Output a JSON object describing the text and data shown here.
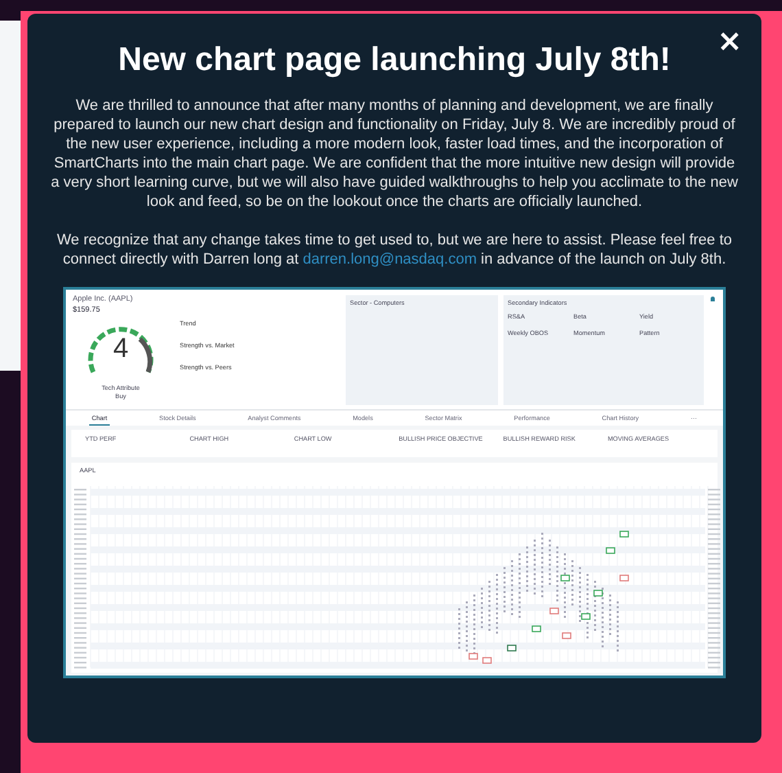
{
  "modal": {
    "close": "×",
    "title": "New chart page launching July 8th!",
    "intro": "We are thrilled to announce that after many months of planning and development, we are finally prepared to launch our new chart design and functionality on Friday, July 8. We are incredibly proud of the new user experience, including a more modern look, faster load times, and the incorporation of SmartCharts into the main chart page. We are confident that the more intuitive new design will provide a very short learning curve, but we will also have guided walkthroughs to help you acclimate to the new look and feed, so be on the lookout once the charts are officially launched.",
    "contact": {
      "before": "We recognize that any change takes time to get used to, but we are here to assist. Please feel free to connect directly with Darren long at ",
      "link": "darren.long@nasdaq.com",
      "after": " in advance of the launch on July 8th."
    }
  },
  "preview": {
    "company": "Apple Inc. (AAPL)",
    "price": "$159.75",
    "rating": "4",
    "rating_label": "Tech Attribute",
    "rating_action": "Buy",
    "indicators": [
      "Trend",
      "Strength vs. Market",
      "Strength vs. Peers"
    ],
    "sector": "Sector - Computers",
    "secondary_title": "Secondary Indicators",
    "secondary": [
      "RS&A",
      "Beta",
      "Yield",
      "Weekly OBOS",
      "Momentum",
      "Pattern"
    ],
    "tabs": [
      {
        "label": "Chart",
        "selected": true
      },
      {
        "label": "Stock Details",
        "selected": false
      },
      {
        "label": "Analyst Comments",
        "selected": false
      },
      {
        "label": "Models",
        "selected": false
      },
      {
        "label": "Sector Matrix",
        "selected": false
      },
      {
        "label": "Performance",
        "selected": false
      },
      {
        "label": "Chart History",
        "selected": false
      },
      {
        "label": "···",
        "selected": false
      }
    ],
    "stats": [
      "YTD PERF",
      "CHART HIGH",
      "CHART LOW",
      "BULLISH PRICE OBJECTIVE",
      "BULLISH REWARD RISK",
      "MOVING AVERAGES"
    ],
    "symbol": "AAPL"
  }
}
